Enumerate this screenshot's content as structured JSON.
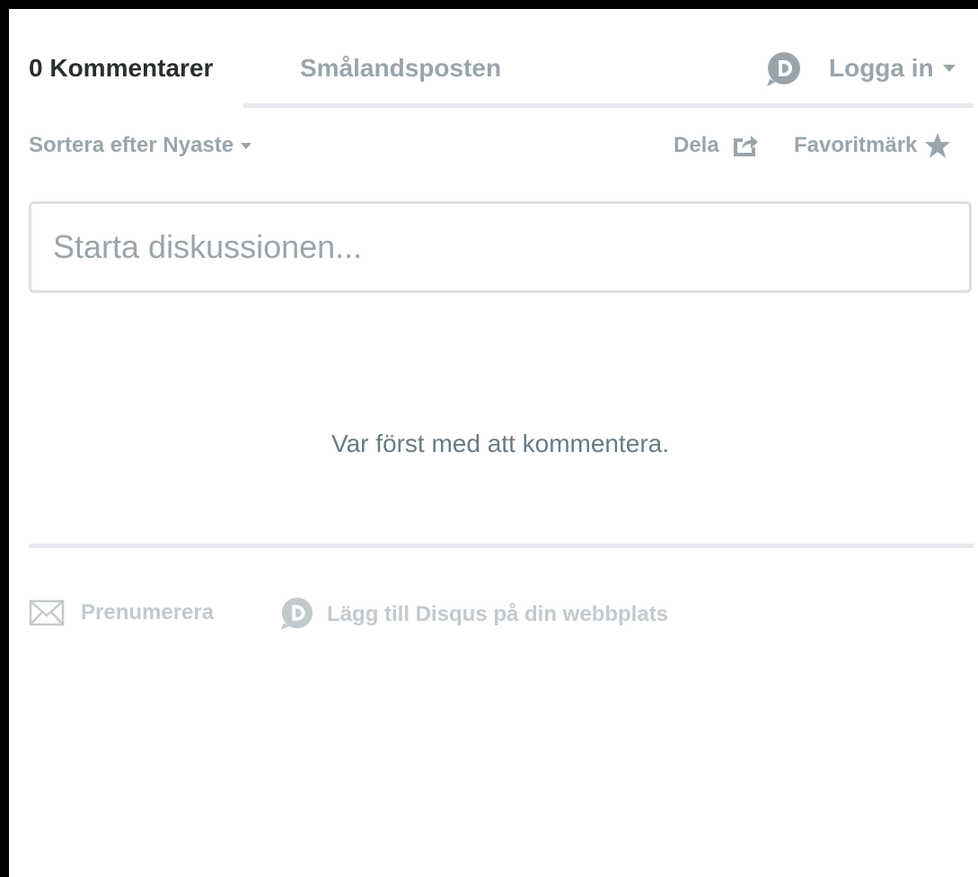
{
  "header": {
    "comment_count_tab": "0 Kommentarer",
    "forum_tab": "Smålandsposten",
    "login_label": "Logga in",
    "login_icon": "disqus-d-icon"
  },
  "toolbar": {
    "sort_label": "Sortera efter Nyaste",
    "share_label": "Dela",
    "favorite_label": "Favoritmärk"
  },
  "composer": {
    "placeholder": "Starta diskussionen..."
  },
  "empty_state": {
    "message": "Var först med att kommentera."
  },
  "footer": {
    "subscribe_label": "Prenumerera",
    "add_disqus_label": "Lägg till Disqus på din webbplats"
  },
  "colors": {
    "text_dark": "#2a2e2e",
    "text_muted": "#9aa5ab",
    "text_faint": "#c3cace",
    "divider": "#e7e9ee"
  }
}
